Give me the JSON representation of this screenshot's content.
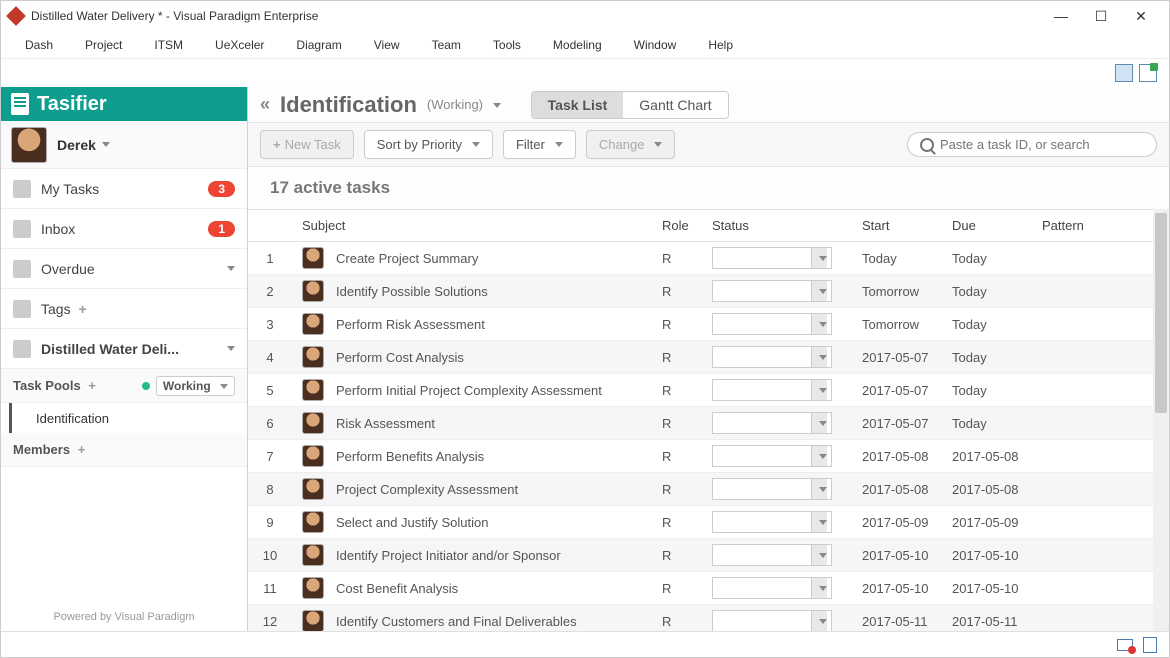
{
  "window": {
    "title": "Distilled Water Delivery * - Visual Paradigm Enterprise"
  },
  "menu": [
    "Dash",
    "Project",
    "ITSM",
    "UeXceler",
    "Diagram",
    "View",
    "Team",
    "Tools",
    "Modeling",
    "Window",
    "Help"
  ],
  "sidebar": {
    "app_name": "Tasifier",
    "user": "Derek",
    "items": [
      {
        "label": "My Tasks",
        "badge": "3"
      },
      {
        "label": "Inbox",
        "badge": "1"
      },
      {
        "label": "Overdue"
      },
      {
        "label": "Tags"
      },
      {
        "label": "Distilled Water Deli..."
      }
    ],
    "task_pools_label": "Task Pools",
    "working_label": "Working",
    "subitem": "Identification",
    "members_label": "Members",
    "footer": "Powered by Visual Paradigm"
  },
  "breadcrumb": {
    "title": "Identification",
    "sub": "(Working)",
    "tabs": {
      "task_list": "Task List",
      "gantt": "Gantt Chart"
    }
  },
  "toolbar": {
    "new_task": "New Task",
    "sort": "Sort by Priority",
    "filter": "Filter",
    "change": "Change",
    "search_placeholder": "Paste a task ID, or search"
  },
  "summary": "17 active tasks",
  "columns": {
    "subject": "Subject",
    "role": "Role",
    "status": "Status",
    "start": "Start",
    "due": "Due",
    "pattern": "Pattern"
  },
  "tasks": [
    {
      "idx": "1",
      "subject": "Create Project Summary",
      "role": "R",
      "start": "Today",
      "due": "Today"
    },
    {
      "idx": "2",
      "subject": "Identify Possible Solutions",
      "role": "R",
      "start": "Tomorrow",
      "due": "Today"
    },
    {
      "idx": "3",
      "subject": "Perform Risk Assessment",
      "role": "R",
      "start": "Tomorrow",
      "due": "Today"
    },
    {
      "idx": "4",
      "subject": "Perform Cost Analysis",
      "role": "R",
      "start": "2017-05-07",
      "due": "Today"
    },
    {
      "idx": "5",
      "subject": "Perform Initial Project Complexity Assessment",
      "role": "R",
      "start": "2017-05-07",
      "due": "Today"
    },
    {
      "idx": "6",
      "subject": "Risk Assessment",
      "role": "R",
      "start": "2017-05-07",
      "due": "Today"
    },
    {
      "idx": "7",
      "subject": "Perform Benefits Analysis",
      "role": "R",
      "start": "2017-05-08",
      "due": "2017-05-08"
    },
    {
      "idx": "8",
      "subject": "Project Complexity Assessment",
      "role": "R",
      "start": "2017-05-08",
      "due": "2017-05-08"
    },
    {
      "idx": "9",
      "subject": "Select and Justify Solution",
      "role": "R",
      "start": "2017-05-09",
      "due": "2017-05-09"
    },
    {
      "idx": "10",
      "subject": "Identify Project Initiator and/or Sponsor",
      "role": "R",
      "start": "2017-05-10",
      "due": "2017-05-10"
    },
    {
      "idx": "11",
      "subject": "Cost Benefit Analysis",
      "role": "R",
      "start": "2017-05-10",
      "due": "2017-05-10"
    },
    {
      "idx": "12",
      "subject": "Identify Customers and Final Deliverables",
      "role": "R",
      "start": "2017-05-11",
      "due": "2017-05-11"
    }
  ]
}
